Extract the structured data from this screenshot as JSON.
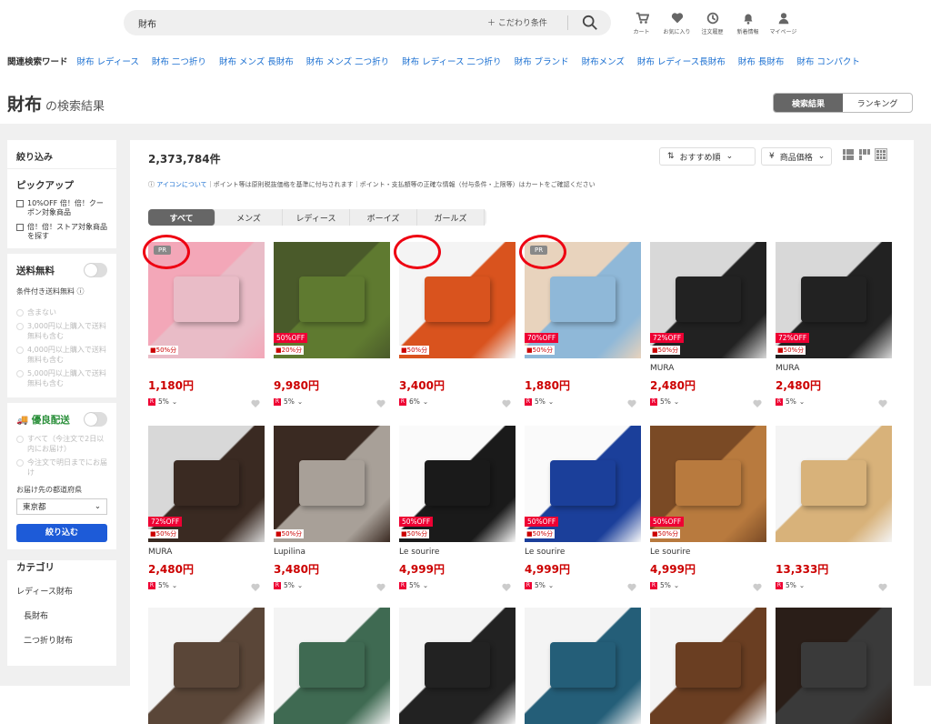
{
  "header": {
    "search_value": "財布",
    "filter_label": "こだわり条件",
    "icons": [
      {
        "name": "cart-icon",
        "label": "カート"
      },
      {
        "name": "heart-icon",
        "label": "お気に入り"
      },
      {
        "name": "history-icon",
        "label": "注文履歴"
      },
      {
        "name": "bell-icon",
        "label": "新着情報"
      },
      {
        "name": "user-icon",
        "label": "マイページ"
      }
    ]
  },
  "keywords": {
    "label": "関連検索ワード",
    "items": [
      "財布 レディース",
      "財布 二つ折り",
      "財布 メンズ 長財布",
      "財布 メンズ 二つ折り",
      "財布 レディース 二つ折り",
      "財布 ブランド",
      "財布メンズ",
      "財布 レディース長財布",
      "財布 長財布",
      "財布 コンパクト"
    ]
  },
  "title": {
    "main": "財布",
    "suffix": "の検索結果"
  },
  "segment": {
    "active": "検索結果",
    "other": "ランキング"
  },
  "sidebar": {
    "header": "絞り込み",
    "pickup_title": "ピックアップ",
    "pickup": [
      "10%OFF 倍！倍！クーポン対象商品",
      "倍！倍！ストア対象商品を探す"
    ],
    "shipping_title": "送料無料",
    "cond_free": "条件付き送料無料",
    "shipping_options": [
      "含まない",
      "3,000円以上購入で送料無料も含む",
      "4,000円以上購入で送料無料も含む",
      "5,000円以上購入で送料無料も含む"
    ],
    "delivery_title": "優良配送",
    "delivery_options": [
      "すべて（今注文で2日以内にお届け）",
      "今注文で明日までにお届け"
    ],
    "pref_label": "お届け先の都道府県",
    "pref_value": "東京都",
    "apply": "絞り込む",
    "cat_title": "カテゴリ",
    "cats": [
      "レディース財布",
      "長財布",
      "二つ折り財布"
    ]
  },
  "results": {
    "count": "2,373,784件",
    "sort": "おすすめ順",
    "price": "商品価格",
    "notice_link": "アイコンについて",
    "notice": "ポイント等は原則税抜価格を基準に付与されます｜ポイント・支払額等の正確な情報（付与条件・上限等）はカートをご確認ください",
    "tabs": [
      "すべて",
      "メンズ",
      "レディース",
      "ボーイズ",
      "ガールズ"
    ]
  },
  "products": [
    {
      "pr": "PR",
      "off": "",
      "pts": "50%分",
      "shop": "",
      "price": "1,180円",
      "rate": "5%",
      "colors": [
        "#f3a7b8",
        "#e9bcc7"
      ],
      "circle": true
    },
    {
      "pr": "",
      "off": "50%OFF",
      "pts": "20%分",
      "shop": "",
      "price": "9,980円",
      "rate": "5%",
      "colors": [
        "#4a5a2a",
        "#5f7a30"
      ],
      "circle": false
    },
    {
      "pr": "",
      "off": "",
      "pts": "50%分",
      "shop": "",
      "price": "3,400円",
      "rate": "6%",
      "colors": [
        "#f4f4f4",
        "#d9531e"
      ],
      "circle": true
    },
    {
      "pr": "PR",
      "off": "70%OFF",
      "pts": "50%分",
      "shop": "",
      "price": "1,880円",
      "rate": "5%",
      "colors": [
        "#e8d3bd",
        "#8fb8d8"
      ],
      "circle": true
    },
    {
      "pr": "",
      "off": "72%OFF",
      "pts": "50%分",
      "shop": "MURA",
      "price": "2,480円",
      "rate": "5%",
      "colors": [
        "#d8d8d8",
        "#222"
      ],
      "circle": false
    },
    {
      "pr": "",
      "off": "72%OFF",
      "pts": "50%分",
      "shop": "MURA",
      "price": "2,480円",
      "rate": "5%",
      "colors": [
        "#d8d8d8",
        "#222"
      ],
      "circle": false
    },
    {
      "pr": "",
      "off": "72%OFF",
      "pts": "50%分",
      "shop": "MURA",
      "price": "2,480円",
      "rate": "5%",
      "colors": [
        "#d8d8d8",
        "#3a2a22"
      ],
      "circle": false
    },
    {
      "pr": "",
      "off": "",
      "pts": "50%分",
      "shop": "Lupilina",
      "price": "3,480円",
      "rate": "5%",
      "colors": [
        "#3a2a22",
        "#a8a098"
      ],
      "circle": false
    },
    {
      "pr": "",
      "off": "50%OFF",
      "pts": "50%分",
      "shop": "Le sourire",
      "price": "4,999円",
      "rate": "5%",
      "colors": [
        "#fafafa",
        "#1a1a1a"
      ],
      "circle": false
    },
    {
      "pr": "",
      "off": "50%OFF",
      "pts": "50%分",
      "shop": "Le sourire",
      "price": "4,999円",
      "rate": "5%",
      "colors": [
        "#fafafa",
        "#1b3f9a"
      ],
      "circle": false
    },
    {
      "pr": "",
      "off": "50%OFF",
      "pts": "50%分",
      "shop": "Le sourire",
      "price": "4,999円",
      "rate": "5%",
      "colors": [
        "#7a4a25",
        "#b87a3e"
      ],
      "circle": false
    },
    {
      "pr": "",
      "off": "",
      "pts": "",
      "shop": "",
      "price": "13,333円",
      "rate": "5%",
      "colors": [
        "#f4f4f4",
        "#d8b27a"
      ],
      "circle": false
    },
    {
      "pr": "",
      "off": "",
      "pts": "",
      "shop": "",
      "price": "",
      "rate": "",
      "colors": [
        "#f4f4f4",
        "#5a4638"
      ],
      "circle": false
    },
    {
      "pr": "",
      "off": "",
      "pts": "",
      "shop": "",
      "price": "",
      "rate": "",
      "colors": [
        "#f4f4f4",
        "#3f6a52"
      ],
      "circle": false
    },
    {
      "pr": "",
      "off": "",
      "pts": "",
      "shop": "",
      "price": "",
      "rate": "",
      "colors": [
        "#f4f4f4",
        "#222"
      ],
      "circle": false
    },
    {
      "pr": "",
      "off": "",
      "pts": "",
      "shop": "",
      "price": "",
      "rate": "",
      "colors": [
        "#f4f4f4",
        "#245e78"
      ],
      "circle": false
    },
    {
      "pr": "",
      "off": "",
      "pts": "",
      "shop": "",
      "price": "",
      "rate": "",
      "colors": [
        "#f4f4f4",
        "#6a3e22"
      ],
      "circle": false
    },
    {
      "pr": "",
      "off": "",
      "pts": "",
      "shop": "",
      "price": "",
      "rate": "",
      "colors": [
        "#2a1e18",
        "#3a3a3a"
      ],
      "circle": false
    }
  ]
}
